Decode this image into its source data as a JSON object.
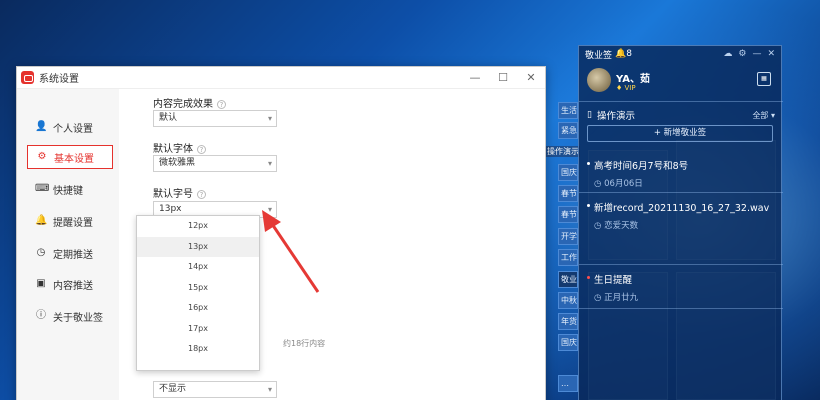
{
  "settings": {
    "window_title": "系统设置",
    "controls": {
      "minimize": "—",
      "maximize": "☐",
      "close": "✕"
    },
    "nav": [
      {
        "label": "个人设置",
        "icon": "user-icon"
      },
      {
        "label": "基本设置",
        "icon": "gear-icon",
        "active": true
      },
      {
        "label": "快捷键",
        "icon": "keyboard-icon"
      },
      {
        "label": "提醒设置",
        "icon": "bell-icon"
      },
      {
        "label": "定期推送",
        "icon": "clock-icon"
      },
      {
        "label": "内容推送",
        "icon": "inbox-icon"
      },
      {
        "label": "关于敬业签",
        "icon": "info-icon"
      }
    ],
    "content_effect": {
      "label": "内容完成效果",
      "value": "默认"
    },
    "font": {
      "label": "默认字体",
      "value": "微软雅黑"
    },
    "size": {
      "label": "默认字号",
      "value": "13px",
      "options": [
        "12px",
        "13px",
        "14px",
        "15px",
        "16px",
        "17px",
        "18px"
      ]
    },
    "hint": "约18行内容",
    "display": {
      "value": "不显示"
    }
  },
  "sticky": {
    "app_name": "敬业签",
    "count": "8",
    "controls": {
      "cloud": "☁",
      "settings": "⚙",
      "minimize": "—",
      "close": "✕"
    },
    "user": {
      "name": "YA、茹",
      "badge": "VIP"
    },
    "section": {
      "title": "操作演示",
      "filter": "全部"
    },
    "new_button": "+ 新增敬业签",
    "notes": [
      {
        "title": "高考时间6月7号和8号",
        "sub": "06月06日"
      },
      {
        "title": "新增record_20211130_16_27_32.wav",
        "sub": "恋爱天数"
      },
      {
        "title": "生日提醒",
        "sub": "正月廿九"
      }
    ]
  },
  "bg_strip": {
    "chips": [
      "生活",
      "紧急",
      "国庆",
      "春节",
      "春节",
      "开学",
      "工作",
      "敬业",
      "中秋",
      "年货",
      "国庆",
      "…"
    ],
    "side_label": "操作演示"
  }
}
